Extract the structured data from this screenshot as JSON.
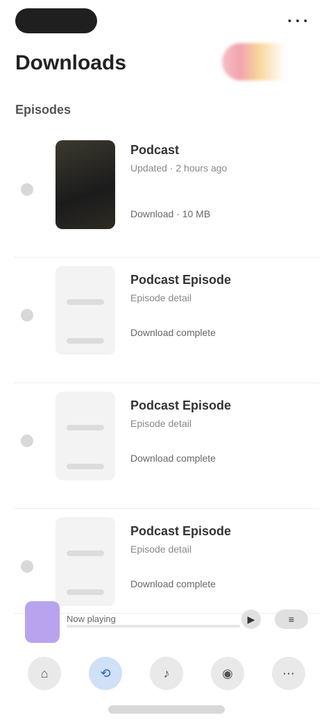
{
  "status": {
    "time": "",
    "signal": "• • •"
  },
  "header": {
    "title": "Downloads"
  },
  "section": {
    "label": "Episodes"
  },
  "list": [
    {
      "title": "Podcast",
      "subtitle": "Updated · 2 hours ago",
      "meta": "Download · 10 MB",
      "thumb": "dark"
    },
    {
      "title": "Podcast Episode",
      "subtitle": "Episode detail",
      "meta": "Download complete",
      "thumb": "light"
    },
    {
      "title": "Podcast Episode",
      "subtitle": "Episode detail",
      "meta": "Download complete",
      "thumb": "light"
    },
    {
      "title": "Podcast Episode",
      "subtitle": "Episode detail",
      "meta": "Download complete",
      "thumb": "light"
    }
  ],
  "now_playing": {
    "title": "Now playing",
    "controls": [
      "play-icon",
      "menu-icon"
    ]
  },
  "tabs": [
    {
      "name": "home-tab",
      "icon": "⌂"
    },
    {
      "name": "explore-tab",
      "icon": "⟲",
      "active": true
    },
    {
      "name": "library-tab",
      "icon": "♪"
    },
    {
      "name": "account-tab",
      "icon": "◉"
    },
    {
      "name": "settings-tab",
      "icon": "⋯"
    }
  ]
}
